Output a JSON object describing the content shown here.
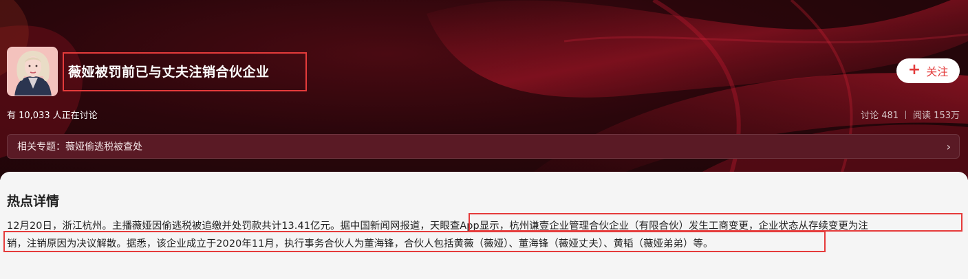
{
  "header": {
    "title": "薇娅被罚前已与丈夫注销合伙企业",
    "follow_label": "关注",
    "discussing": "有 10,033 人正在讨论",
    "stats": {
      "comments": "讨论 481",
      "reads": "阅读 153万"
    },
    "topic": "相关专题：薇娅偷逃税被查处"
  },
  "details": {
    "heading": "热点详情",
    "line1": "12月20日，浙江杭州。主播薇娅因偷逃税被追缴并处罚款共计13.41亿元。据中国新闻网报道，天眼查App显示，杭州谦壹企业管理合伙企业（有限合伙）发生工商变更，企业状态从存续变更为注",
    "line2": "销，注销原因为决议解散。据悉，该企业成立于2020年11月，执行事务合伙人为董海锋，合伙人包括黄薇（薇娅）、董海锋（薇娅丈夫）、黄韬（薇娅弟弟）等。"
  },
  "icons": {
    "follow": "plus-icon",
    "topic": "chevron-right-icon"
  },
  "colors": {
    "accent": "#e33a3a",
    "highlight_box": "#e53b3b",
    "hero_bg": "#2a060b"
  }
}
